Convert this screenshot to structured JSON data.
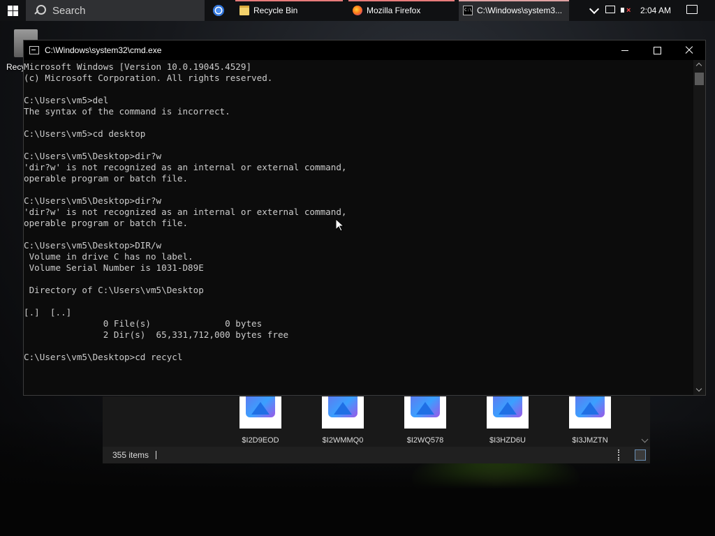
{
  "taskbar": {
    "search_label": "Search",
    "tasks": [
      {
        "label": "Recycle Bin",
        "icon": "folder-icon"
      },
      {
        "label": "Mozilla Firefox",
        "icon": "firefox-icon"
      },
      {
        "label": "C:\\Windows\\system3...",
        "icon": "cmd-icon"
      }
    ],
    "clock": "2:04 AM"
  },
  "desktop": {
    "icon_label": "Recy"
  },
  "cmd_window": {
    "title": "C:\\Windows\\system32\\cmd.exe",
    "lines": [
      "Microsoft Windows [Version 10.0.19045.4529]",
      "(c) Microsoft Corporation. All rights reserved.",
      "",
      "C:\\Users\\vm5>del",
      "The syntax of the command is incorrect.",
      "",
      "C:\\Users\\vm5>cd desktop",
      "",
      "C:\\Users\\vm5\\Desktop>dir?w",
      "'dir?w' is not recognized as an internal or external command,",
      "operable program or batch file.",
      "",
      "C:\\Users\\vm5\\Desktop>dir?w",
      "'dir?w' is not recognized as an internal or external command,",
      "operable program or batch file.",
      "",
      "C:\\Users\\vm5\\Desktop>DIR/w",
      " Volume in drive C has no label.",
      " Volume Serial Number is 1031-D89E",
      "",
      " Directory of C:\\Users\\vm5\\Desktop",
      "",
      "[.]  [..]",
      "               0 File(s)              0 bytes",
      "               2 Dir(s)  65,331,712,000 bytes free",
      "",
      "C:\\Users\\vm5\\Desktop>cd recycl"
    ]
  },
  "explorer": {
    "files": [
      "$I2D9EOD",
      "$I2WMMQ0",
      "$I2WQ578",
      "$I3HZD6U",
      "$I3JMZTN"
    ],
    "status_count": "355 items"
  }
}
